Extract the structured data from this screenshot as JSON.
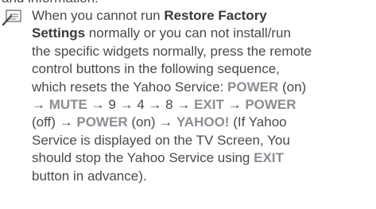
{
  "top_fragment": "and information.",
  "note": {
    "icon": "pencil-note-icon",
    "lines": [
      [
        {
          "t": "When you cannot run ",
          "s": ""
        },
        {
          "t": "Restore Factory",
          "s": "b"
        }
      ],
      [
        {
          "t": "Settings",
          "s": "b"
        },
        {
          "t": " normally or you can not install/run",
          "s": ""
        }
      ],
      [
        {
          "t": "the specific widgets normally, press the remote",
          "s": ""
        }
      ],
      [
        {
          "t": "control buttons in the following sequence,",
          "s": ""
        }
      ],
      [
        {
          "t": "which resets the Yahoo Service: ",
          "s": ""
        },
        {
          "t": "POWER",
          "s": "key"
        },
        {
          "t": " (on)",
          "s": ""
        }
      ],
      [
        {
          "t": "→ ",
          "s": ""
        },
        {
          "t": "MUTE",
          "s": "key"
        },
        {
          "t": " → 9 → 4 → 8 → ",
          "s": ""
        },
        {
          "t": "EXIT",
          "s": "key"
        },
        {
          "t": " → ",
          "s": ""
        },
        {
          "t": "POWER",
          "s": "key"
        }
      ],
      [
        {
          "t": "(off) → ",
          "s": ""
        },
        {
          "t": "POWER",
          "s": "key"
        },
        {
          "t": " (on) → ",
          "s": ""
        },
        {
          "t": "YAHOO!",
          "s": "key"
        },
        {
          "t": " (If Yahoo",
          "s": ""
        }
      ],
      [
        {
          "t": "Service is displayed on the TV Screen, You",
          "s": ""
        }
      ],
      [
        {
          "t": "should stop the Yahoo Service using ",
          "s": ""
        },
        {
          "t": "EXIT",
          "s": "key"
        }
      ],
      [
        {
          "t": "button in advance).",
          "s": ""
        }
      ]
    ]
  },
  "colors": {
    "text": "#4a4a4a",
    "bold": "#3a3a3a",
    "key": "#8a8d92"
  }
}
